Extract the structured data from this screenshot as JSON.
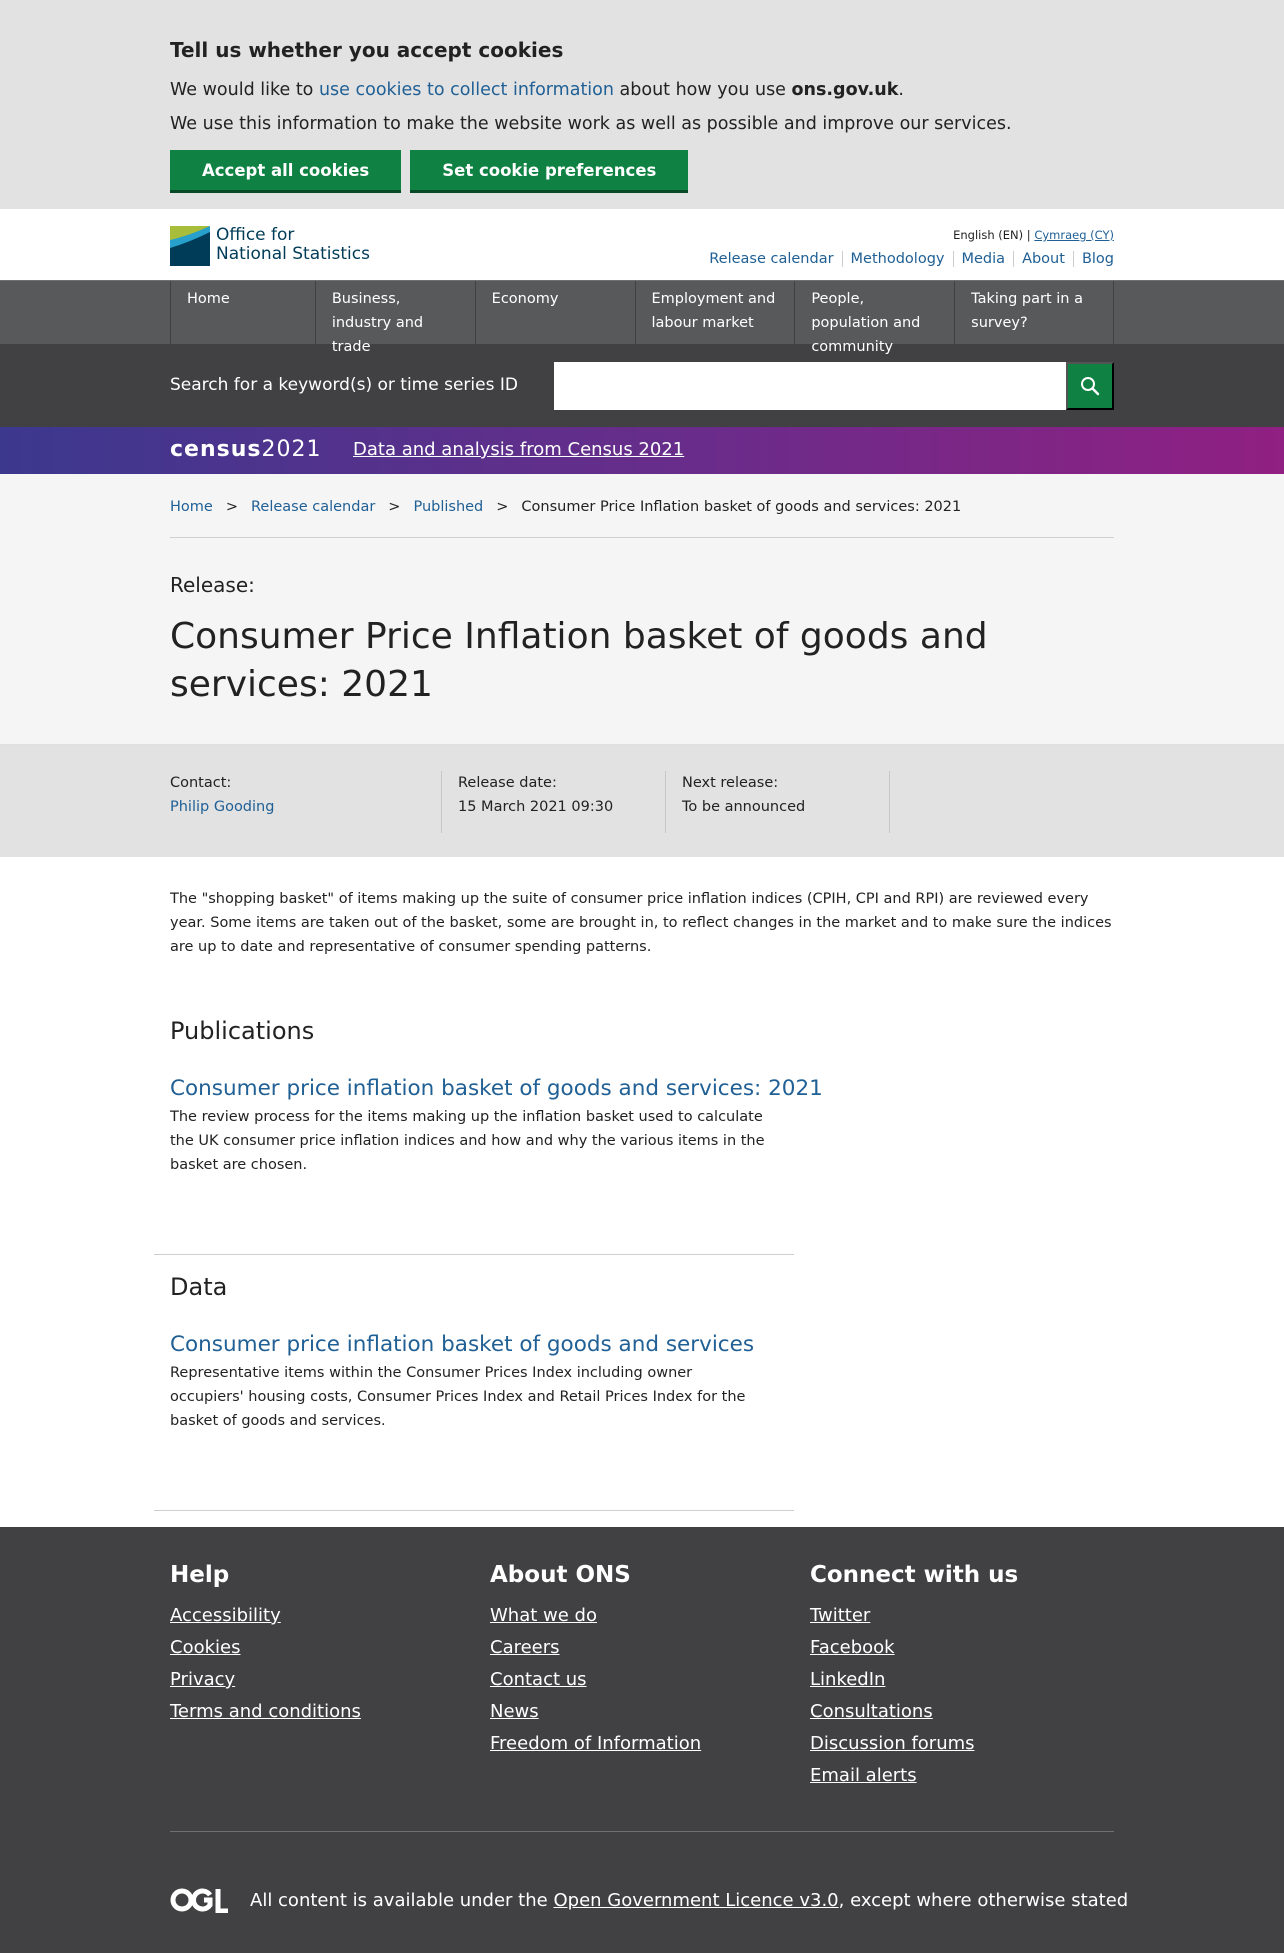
{
  "cookies": {
    "heading": "Tell us whether you accept cookies",
    "line1_pre": "We would like to ",
    "line1_link": "use cookies to collect information",
    "line1_mid": " about how you use ",
    "line1_bold": "ons.gov.uk",
    "line1_post": ".",
    "line2": "We use this information to make the website work as well as possible and improve our services.",
    "accept_label": "Accept all cookies",
    "prefs_label": "Set cookie preferences"
  },
  "header": {
    "logo_line1": "Office for",
    "logo_line2": "National Statistics",
    "lang_en": "English (EN) | ",
    "lang_cy": "Cymraeg (CY)",
    "links": [
      "Release calendar",
      "Methodology",
      "Media",
      "About",
      "Blog"
    ]
  },
  "nav": {
    "items": [
      {
        "label": "Home"
      },
      {
        "label": "Business, industry and trade"
      },
      {
        "label": "Economy"
      },
      {
        "label": "Employment and labour market"
      },
      {
        "label": "People, population and community"
      },
      {
        "label": "Taking part in a survey?"
      }
    ]
  },
  "search": {
    "label": "Search for a keyword(s) or time series ID",
    "placeholder": ""
  },
  "census": {
    "logo_word": "census",
    "logo_year": "2021",
    "link": "Data and analysis from Census 2021"
  },
  "breadcrumb": {
    "home": "Home",
    "release_calendar": "Release calendar",
    "published": "Published",
    "current": "Consumer Price Inflation basket of goods and services: 2021",
    "sep": ">"
  },
  "page": {
    "release_label": "Release:",
    "title": "Consumer Price Inflation basket of goods and services: 2021"
  },
  "meta": {
    "contact_label": "Contact:",
    "contact_name": "Philip Gooding",
    "release_date_label": "Release date:",
    "release_date": "15 March 2021 09:30",
    "next_release_label": "Next release:",
    "next_release": "To be announced"
  },
  "summary": "The \"shopping basket\" of items making up the suite of consumer price inflation indices (CPIH, CPI and RPI) are reviewed every year. Some items are taken out of the basket, some are brought in, to reflect changes in the market and to make sure the indices are up to date and representative of consumer spending patterns.",
  "publications": {
    "heading": "Publications",
    "title": "Consumer price inflation basket of goods and services: 2021",
    "desc": "The review process for the items making up the inflation basket used to calculate the UK consumer price inflation indices and how and why the various items in the basket are chosen."
  },
  "data_section": {
    "heading": "Data",
    "title": "Consumer price inflation basket of goods and services",
    "desc": "Representative items within the Consumer Prices Index including owner occupiers' housing costs, Consumer Prices Index and Retail Prices Index for the basket of goods and services."
  },
  "footer": {
    "help": {
      "heading": "Help",
      "links": [
        "Accessibility",
        "Cookies",
        "Privacy",
        "Terms and conditions"
      ]
    },
    "about": {
      "heading": "About ONS",
      "links": [
        "What we do",
        "Careers",
        "Contact us",
        "News",
        "Freedom of Information"
      ]
    },
    "connect": {
      "heading": "Connect with us",
      "links": [
        "Twitter",
        "Facebook",
        "LinkedIn",
        "Consultations",
        "Discussion forums",
        "Email alerts"
      ]
    },
    "licence_pre": "All content is available under the ",
    "licence_link": "Open Government Licence v3.0",
    "licence_post": ", except where otherwise stated"
  },
  "colors": {
    "ons_green": "#0f8243",
    "link_blue": "#206095",
    "nav_grey": "#58595b",
    "footer_grey": "#414042"
  }
}
